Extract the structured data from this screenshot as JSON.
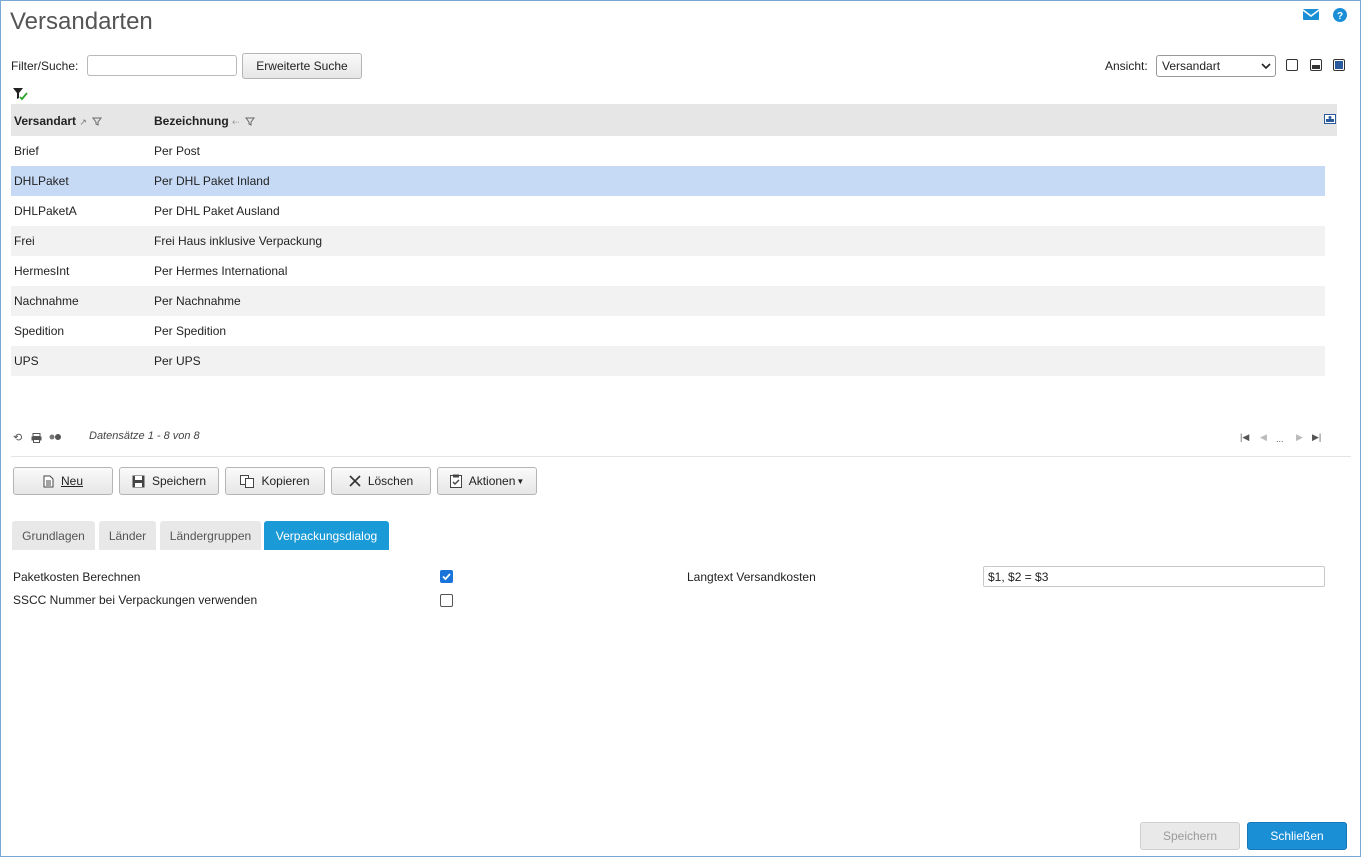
{
  "title": "Versandarten",
  "filter": {
    "label": "Filter/Suche:",
    "value": "",
    "advanced_button": "Erweiterte Suche"
  },
  "view": {
    "label": "Ansicht:",
    "selected": "Versandart"
  },
  "grid": {
    "columns": [
      "Versandart",
      "Bezeichnung"
    ],
    "rows": [
      {
        "code": "Brief",
        "label": "Per Post"
      },
      {
        "code": "DHLPaket",
        "label": "Per DHL Paket Inland"
      },
      {
        "code": "DHLPaketA",
        "label": "Per DHL Paket Ausland"
      },
      {
        "code": "Frei",
        "label": "Frei Haus inklusive Verpackung"
      },
      {
        "code": "HermesInt",
        "label": "Per Hermes International"
      },
      {
        "code": "Nachnahme",
        "label": "Per Nachnahme"
      },
      {
        "code": "Spedition",
        "label": "Per Spedition"
      },
      {
        "code": "UPS",
        "label": "Per UPS"
      }
    ],
    "selected_row": "DHLPaket",
    "pager_text": "Datensätze 1 - 8 von 8",
    "pager_ellipsis": "..."
  },
  "actions": {
    "new": "Neu",
    "save": "Speichern",
    "copy": "Kopieren",
    "delete": "Löschen",
    "more": "Aktionen"
  },
  "tabs": [
    "Grundlagen",
    "Länder",
    "Ländergruppen",
    "Verpackungsdialog"
  ],
  "active_tab": "Verpackungsdialog",
  "form": {
    "paketkosten_label": "Paketkosten Berechnen",
    "paketkosten_checked": true,
    "sscc_label": "SSCC Nummer bei Verpackungen verwenden",
    "sscc_checked": false,
    "langtext_label": "Langtext Versandkosten",
    "langtext_value": "$1, $2 = $3"
  },
  "footer": {
    "save": "Speichern",
    "close": "Schließen"
  },
  "colors": {
    "accent": "#1a9ad6",
    "selected_row": "#c6daf6"
  }
}
